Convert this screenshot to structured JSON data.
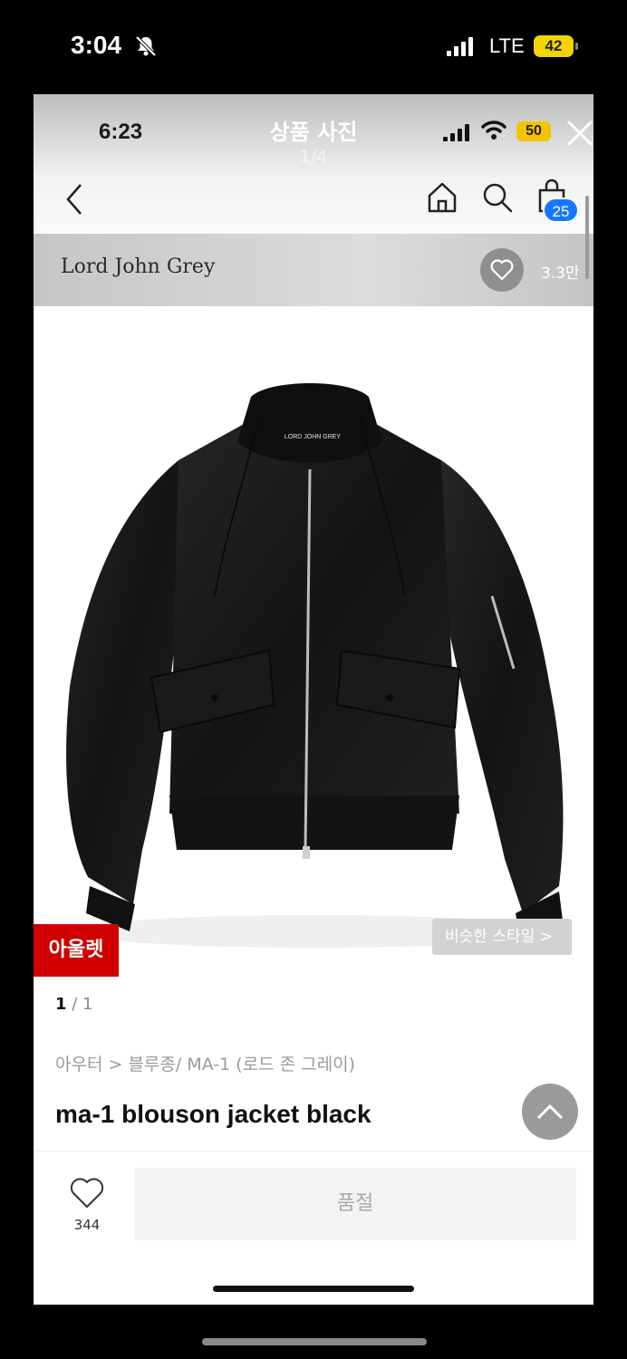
{
  "outer_status": {
    "time": "3:04",
    "network": "LTE",
    "battery": "42"
  },
  "inner_status": {
    "time": "6:23",
    "battery": "50"
  },
  "viewer": {
    "title": "상품 사진",
    "counter": "1/4"
  },
  "header": {
    "cart_count": "25"
  },
  "brand": {
    "name": "Lord John Grey",
    "likes": "3.3만"
  },
  "product": {
    "outlet_label": "아울렛",
    "similar_style_label": "비슷한 스타일 >",
    "image_index": "1",
    "image_total": "/ 1",
    "breadcrumb": "아우터 > 블루종/ MA-1 (로드 존 그레이)",
    "title": "ma-1 blouson jacket black",
    "collar_text": "LORD JOHN GREY"
  },
  "bottom": {
    "like_count": "344",
    "buy_label": "품절"
  },
  "icons": [
    "bell-slash-icon",
    "signal-icon",
    "wifi-icon",
    "close-icon",
    "back-icon",
    "home-icon",
    "search-icon",
    "cart-icon",
    "heart-icon",
    "chevron-up-icon"
  ]
}
